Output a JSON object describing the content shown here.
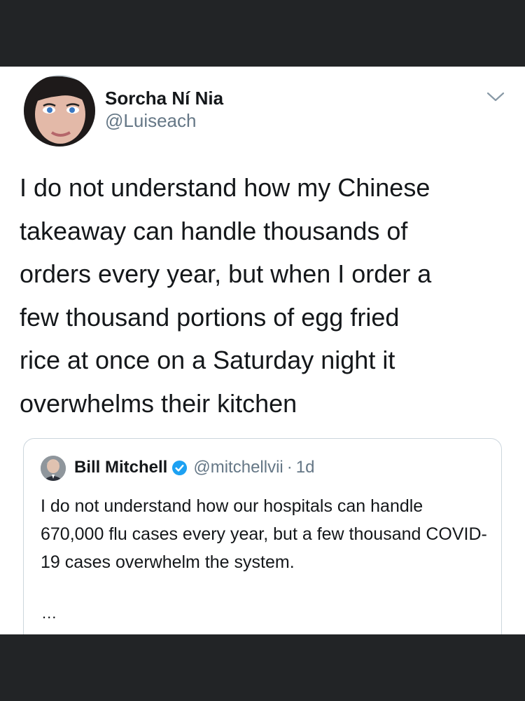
{
  "tweet": {
    "author_name": "Sorcha Ní Nia",
    "author_handle": "@Luiseach",
    "text": "I do not understand how my Chinese\ntakeaway can handle thousands of\norders every year, but when I order a\nfew thousand portions of egg fried\nrice at once on a Saturday night it\noverwhelms their kitchen"
  },
  "quoted_tweet": {
    "author_name": "Bill Mitchell",
    "author_handle": "@mitchellvii",
    "separator": "·",
    "time": "1d",
    "text": "I do not understand how our hospitals can handle 670,000 flu cases every year, but a few thousand COVID-19 cases overwhelm the system.",
    "more": "..."
  },
  "icons": {
    "menu": "chevron-down-icon",
    "verified": "verified-badge-icon"
  },
  "colors": {
    "background": "#ffffff",
    "frame": "#222426",
    "text": "#14171a",
    "secondary": "#657786",
    "verified": "#1da1f2",
    "border": "#ccd6dd"
  }
}
